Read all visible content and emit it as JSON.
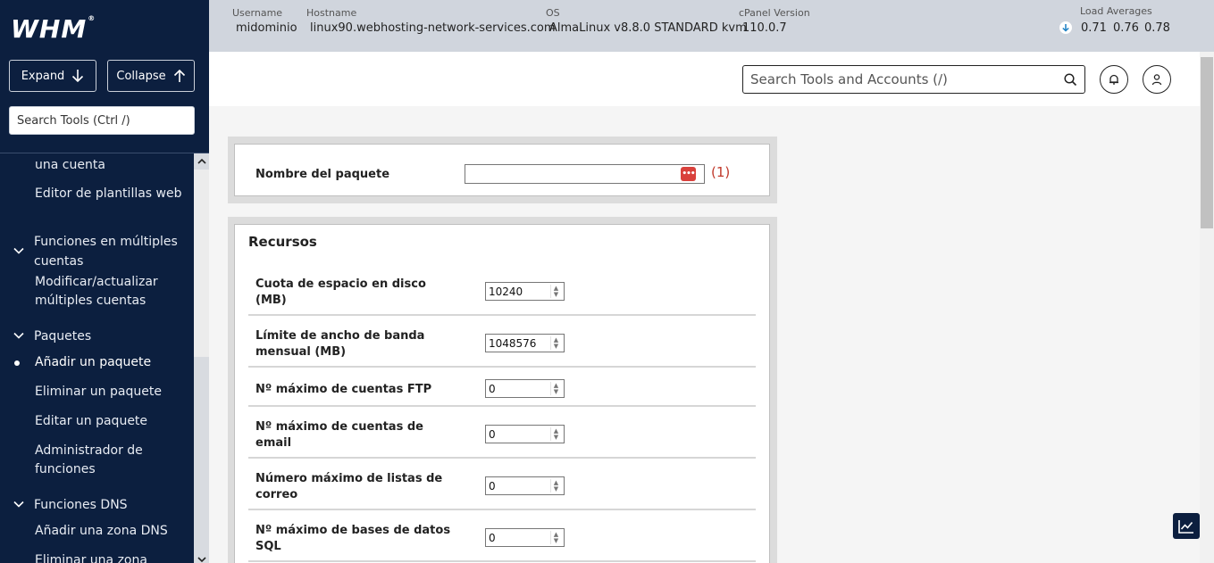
{
  "app": {
    "logo": "WHM"
  },
  "sidebar": {
    "expand_label": "Expand",
    "collapse_label": "Collapse",
    "search_placeholder": "Search Tools (Ctrl /)",
    "items": {
      "crear_cuenta_tail": "una cuenta",
      "editor_plantillas": "Editor de plantillas web",
      "funciones_multiples": "Funciones en múltiples cuentas",
      "modificar_multiples": "Modificar/actualizar múltiples cuentas",
      "paquetes": "Paquetes",
      "anadir_paquete": "Añadir un paquete",
      "eliminar_paquete": "Eliminar un paquete",
      "editar_paquete": "Editar un paquete",
      "admin_funciones": "Administrador de funciones",
      "funciones_dns": "Funciones DNS",
      "anadir_zona": "Añadir una zona DNS",
      "eliminar_zona": "Eliminar una zona"
    }
  },
  "header": {
    "username_label": "Username",
    "username": "midominio",
    "hostname_label": "Hostname",
    "hostname": "linux90.webhosting-network-services.com",
    "os_label": "OS",
    "os": "AlmaLinux v8.8.0 STANDARD kvm",
    "cpanel_label": "cPanel Version",
    "cpanel_version": "110.0.7",
    "load_label": "Load Averages",
    "load_1": "0.71",
    "load_5": "0.76",
    "load_15": "0.78"
  },
  "search": {
    "placeholder": "Search Tools and Accounts (/)"
  },
  "form": {
    "package_name_label": "Nombre del paquete",
    "package_name_value": "",
    "required_mark": "(1)",
    "resources_title": "Recursos",
    "fields": [
      {
        "label": "Cuota de espacio en disco (MB)",
        "value": "10240"
      },
      {
        "label": "Límite de ancho de banda mensual (MB)",
        "value": "1048576"
      },
      {
        "label": "Nº máximo de cuentas FTP",
        "value": "0"
      },
      {
        "label": "Nº máximo de cuentas de email",
        "value": "0"
      },
      {
        "label": "Número máximo de listas de correo",
        "value": "0"
      },
      {
        "label": "Nº máximo de bases de datos SQL",
        "value": "0"
      }
    ]
  },
  "colors": {
    "sidebar_bg": "#0c1f3f",
    "header_bg": "#d0d5dd",
    "required": "#c0392b",
    "password_icon": "#d9413c"
  }
}
